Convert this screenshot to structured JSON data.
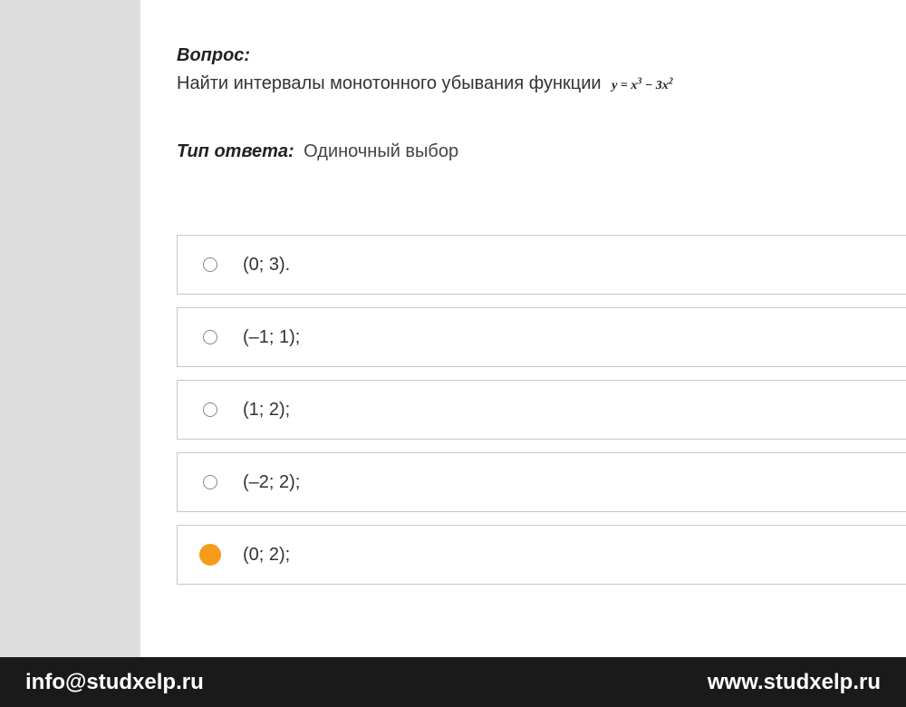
{
  "question": {
    "label": "Вопрос:",
    "text": "Найти интервалы монотонного убывания функции ",
    "formula_plain": "y = x³ − 3x²"
  },
  "answer_type": {
    "label": "Тип ответа:",
    "value": "Одиночный выбор"
  },
  "options": [
    {
      "text": "(0; 3).",
      "selected": false
    },
    {
      "text": "(–1; 1);",
      "selected": false
    },
    {
      "text": "(1; 2);",
      "selected": false
    },
    {
      "text": "(–2; 2);",
      "selected": false
    },
    {
      "text": "(0; 2);",
      "selected": true
    }
  ],
  "footer": {
    "email": "info@studxelp.ru",
    "website": "www.studxelp.ru"
  }
}
